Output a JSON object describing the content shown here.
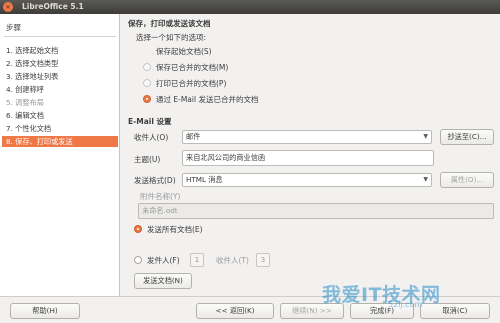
{
  "window": {
    "title": "LibreOffice 5.1",
    "close_glyph": "×"
  },
  "sidebar": {
    "title": "步骤",
    "steps": [
      {
        "label": "1. 选择起始文档",
        "state": "normal"
      },
      {
        "label": "2. 选择文档类型",
        "state": "normal"
      },
      {
        "label": "3. 选择地址列表",
        "state": "normal"
      },
      {
        "label": "4. 创建称呼",
        "state": "normal"
      },
      {
        "label": "5. 调整布局",
        "state": "disabled"
      },
      {
        "label": "6. 编辑文档",
        "state": "normal"
      },
      {
        "label": "7. 个性化文档",
        "state": "normal"
      },
      {
        "label": "8. 保存、打印或发送",
        "state": "active"
      }
    ]
  },
  "main": {
    "heading": "保存，打印或发送该文档",
    "choose_prompt": "选择一个如下的选项:",
    "save_start": "保存起始文档(S)",
    "options": [
      {
        "label": "保存已合并的文档(M)",
        "selected": false
      },
      {
        "label": "打印已合并的文档(P)",
        "selected": false
      },
      {
        "label": "通过 E-Mail 发送已合并的文档",
        "selected": true
      }
    ],
    "email_heading": "E-Mail 设置",
    "recipient_label": "收件人(O)",
    "recipient_value": "邮件",
    "copy_to_button": "抄送至(C)...",
    "subject_label": "主题(U)",
    "subject_value": "来自北风公司的商业信函",
    "send_format_label": "发送格式(D)",
    "send_format_value": "HTML 消息",
    "properties_button": "属性(O)...",
    "attachment_label": "附件名称(Y)",
    "attachment_value": "未命名.odt",
    "send_all_label": "发送所有文档(E)",
    "sender_label": "发件人(F)",
    "sender_value": "1",
    "receiver_label": "收件人(T)",
    "receiver_value": "3",
    "send_docs_button": "发送文档(N)"
  },
  "footer": {
    "help": "帮助(H)",
    "back": "<< 返回(K)",
    "next": "继续(N) >>",
    "finish": "完成(F)",
    "cancel": "取消(C)"
  },
  "watermark": {
    "text": "我爱IT技术网",
    "sub": "52ij.com"
  },
  "colors": {
    "accent": "#f07746",
    "titlebar": "#3d3c38",
    "background": "#f2f1f0"
  }
}
